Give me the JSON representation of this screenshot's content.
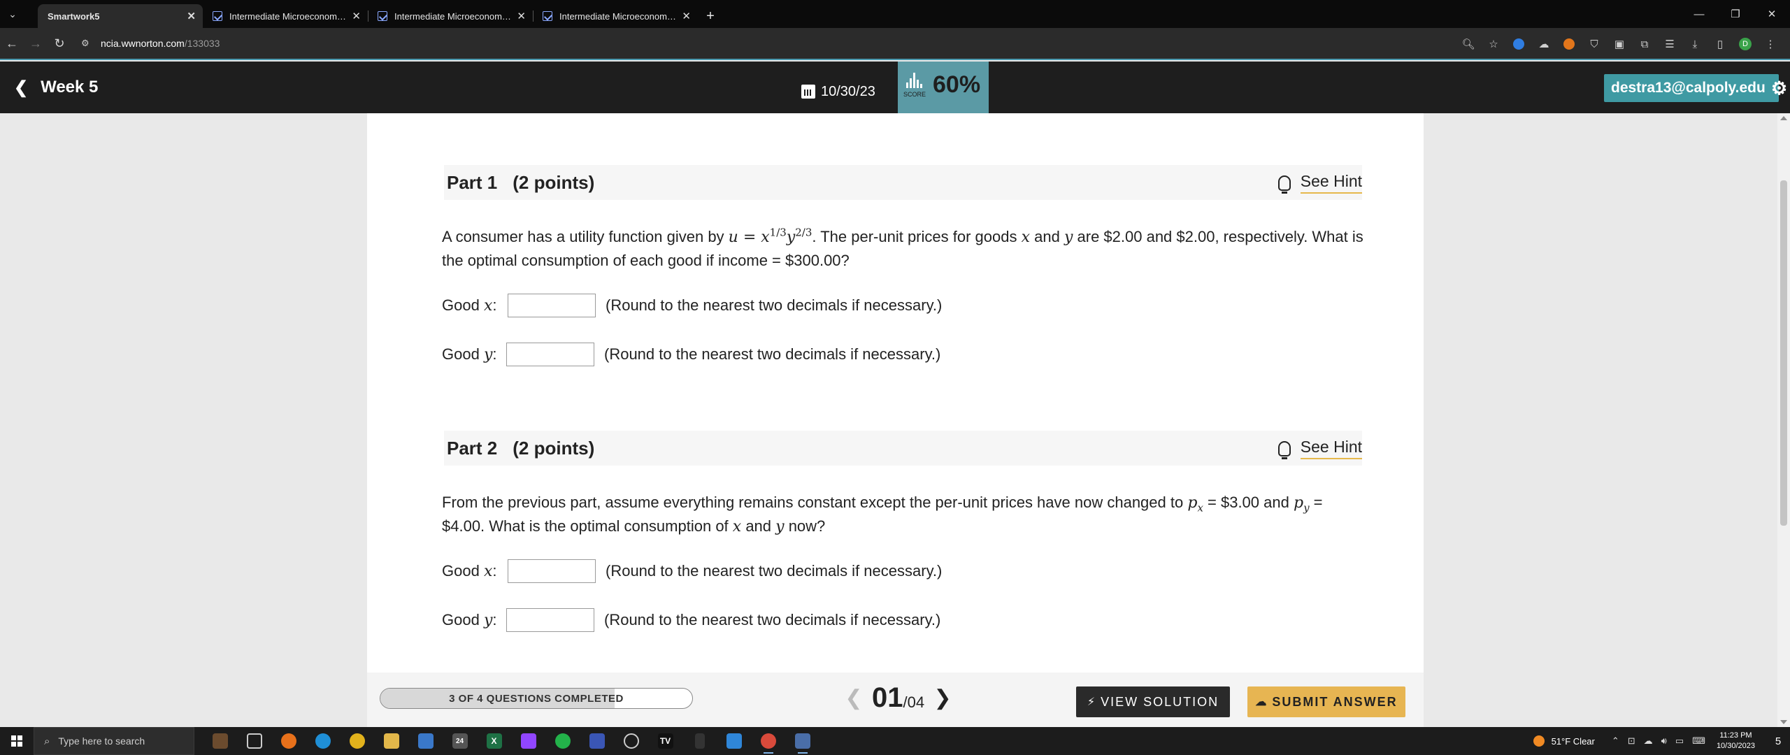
{
  "browser": {
    "tabs": [
      {
        "title": "Smartwork5",
        "active": true
      },
      {
        "title": "Intermediate Microeconomics",
        "active": false
      },
      {
        "title": "Intermediate Microeconomics",
        "active": false
      },
      {
        "title": "Intermediate Microeconomics",
        "active": false
      }
    ],
    "url_host": "ncia.wwnorton.com",
    "url_path": "/133033",
    "profile_initial": "D"
  },
  "header": {
    "week_label": "Week 5",
    "date": "10/30/23",
    "score_label": "SCORE",
    "score_value": "60%",
    "user_email": "destra13@calpoly.edu"
  },
  "parts": [
    {
      "title": "Part 1",
      "points": "(2 points)",
      "hint_label": "See Hint",
      "question": {
        "t1": "A consumer has a utility function given by ",
        "t2": ". The per-unit prices for goods ",
        "t3": " and ",
        "t4": " are $2.00 and $2.00, respectively. What is the optimal consumption of each good if income = $300.00?"
      },
      "answers": [
        {
          "label": "Good ",
          "var": "x",
          "colon": ":",
          "value": "",
          "note": "(Round to the nearest two decimals if necessary.)"
        },
        {
          "label": "Good ",
          "var": "y",
          "colon": ":",
          "value": "",
          "note": "(Round to the nearest two decimals if necessary.)"
        }
      ]
    },
    {
      "title": "Part 2",
      "points": "(2 points)",
      "hint_label": "See Hint",
      "question": {
        "t1": "From the previous part, assume everything remains constant except the per-unit prices have now changed to ",
        "t2": " = $3.00 and ",
        "t3": " = $4.00. What is the optimal consumption of ",
        "t4": " and ",
        "t5": " now?"
      },
      "answers": [
        {
          "label": "Good ",
          "var": "x",
          "colon": ":",
          "value": "",
          "note": "(Round to the nearest two decimals if necessary.)"
        },
        {
          "label": "Good ",
          "var": "y",
          "colon": ":",
          "value": "",
          "note": "(Round to the nearest two decimals if necessary.)"
        }
      ]
    }
  ],
  "footer": {
    "progress_label": "3 OF 4 QUESTIONS COMPLETED",
    "progress_fraction": 0.75,
    "current_page": "01",
    "total_pages": "/04",
    "view_solution": "VIEW SOLUTION",
    "submit_answer": "SUBMIT ANSWER"
  },
  "taskbar": {
    "search_placeholder": "Type here to search",
    "badge": "24",
    "weather": "51°F  Clear",
    "time": "11:23 PM",
    "date": "10/30/2023",
    "notif_count": "5"
  },
  "colors": {
    "score_bg": "#5b9aa5",
    "user_bg": "#3f9aa3",
    "submit_bg": "#e7b552",
    "hint_underline": "#e6b84c"
  }
}
